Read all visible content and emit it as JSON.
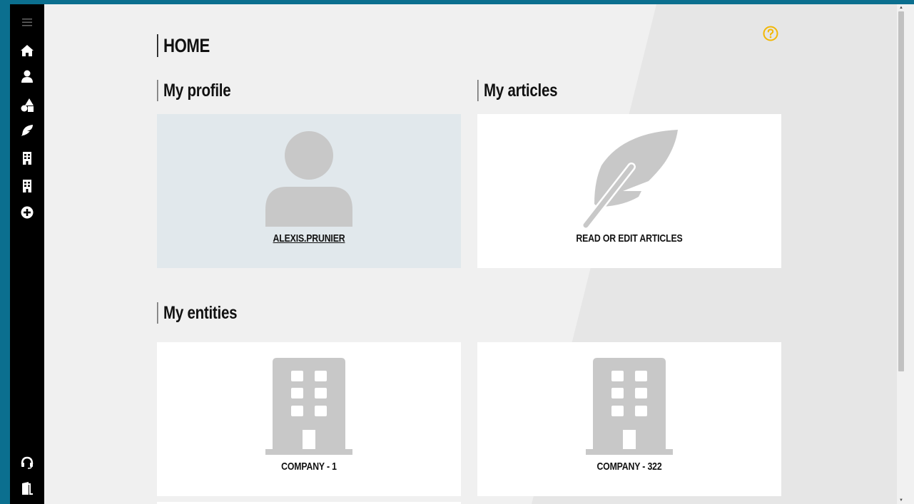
{
  "page": {
    "title": "HOME"
  },
  "sidebar": {
    "items": [
      {
        "icon": "hamburger-icon"
      },
      {
        "icon": "home-icon"
      },
      {
        "icon": "user-icon"
      },
      {
        "icon": "shapes-icon"
      },
      {
        "icon": "feather-icon"
      },
      {
        "icon": "building-icon"
      },
      {
        "icon": "building-icon"
      },
      {
        "icon": "plus-circle-icon"
      }
    ],
    "bottom": [
      {
        "icon": "headset-icon"
      },
      {
        "icon": "exit-door-icon"
      }
    ]
  },
  "sections": {
    "profile": {
      "title": "My profile",
      "card_label": "ALEXIS.PRUNIER"
    },
    "articles": {
      "title": "My articles",
      "card_label": "READ OR EDIT ARTICLES"
    },
    "entities": {
      "title": "My entities",
      "cards": [
        {
          "label": "COMPANY - 1"
        },
        {
          "label": "COMPANY - 322"
        }
      ]
    }
  },
  "colors": {
    "accent": "#f2b705",
    "sidebar": "#000000",
    "icon_gray": "#c8c8c8",
    "frame": "#0b6f8f"
  }
}
